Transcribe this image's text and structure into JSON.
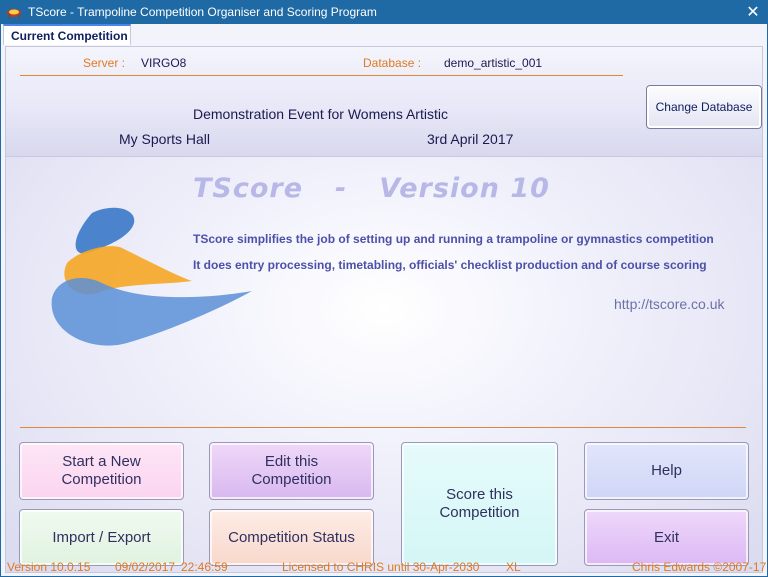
{
  "window": {
    "title": "TScore - Trampoline Competition Organiser and Scoring Program",
    "close_glyph": "✕"
  },
  "tab": {
    "label": "Current Competition"
  },
  "header": {
    "server_label": "Server :",
    "server_value": "VIRGO8",
    "database_label": "Database :",
    "database_value": "demo_artistic_001",
    "event_name": "Demonstration Event for Womens Artistic",
    "venue": "My Sports Hall",
    "date": "3rd April 2017",
    "change_database_label": "Change Database"
  },
  "branding": {
    "product": "TScore",
    "dash": "-",
    "version": "Version 10",
    "blurb_line1": "TScore simplifies the job of setting up and running a trampoline or gymnastics competition",
    "blurb_line2": "It does entry processing, timetabling, officials' checklist production and of course scoring",
    "url": "http://tscore.co.uk"
  },
  "buttons": {
    "start_new_line1": "Start a New",
    "start_new_line2": "Competition",
    "edit_line1": "Edit this",
    "edit_line2": "Competition",
    "score_line1": "Score this",
    "score_line2": "Competition",
    "help": "Help",
    "import_export": "Import / Export",
    "competition_status": "Competition Status",
    "exit": "Exit"
  },
  "status": {
    "version": "Version 10.0.15",
    "date": "09/02/2017",
    "time": "22:46:59",
    "license": "Licensed to CHRIS until 30-Apr-2030",
    "edition": "XL",
    "copyright": "Chris Edwards ©2007-17"
  },
  "colors": {
    "titlebar": "#1f6aa5",
    "label_orange": "#e07a20",
    "text_dark": "#1a1a50",
    "brand_light": "#b8b8e8",
    "blurb": "#4c50a8"
  },
  "icons": {
    "app": "trampoline-app-icon",
    "logo": "swoosh-logo"
  }
}
